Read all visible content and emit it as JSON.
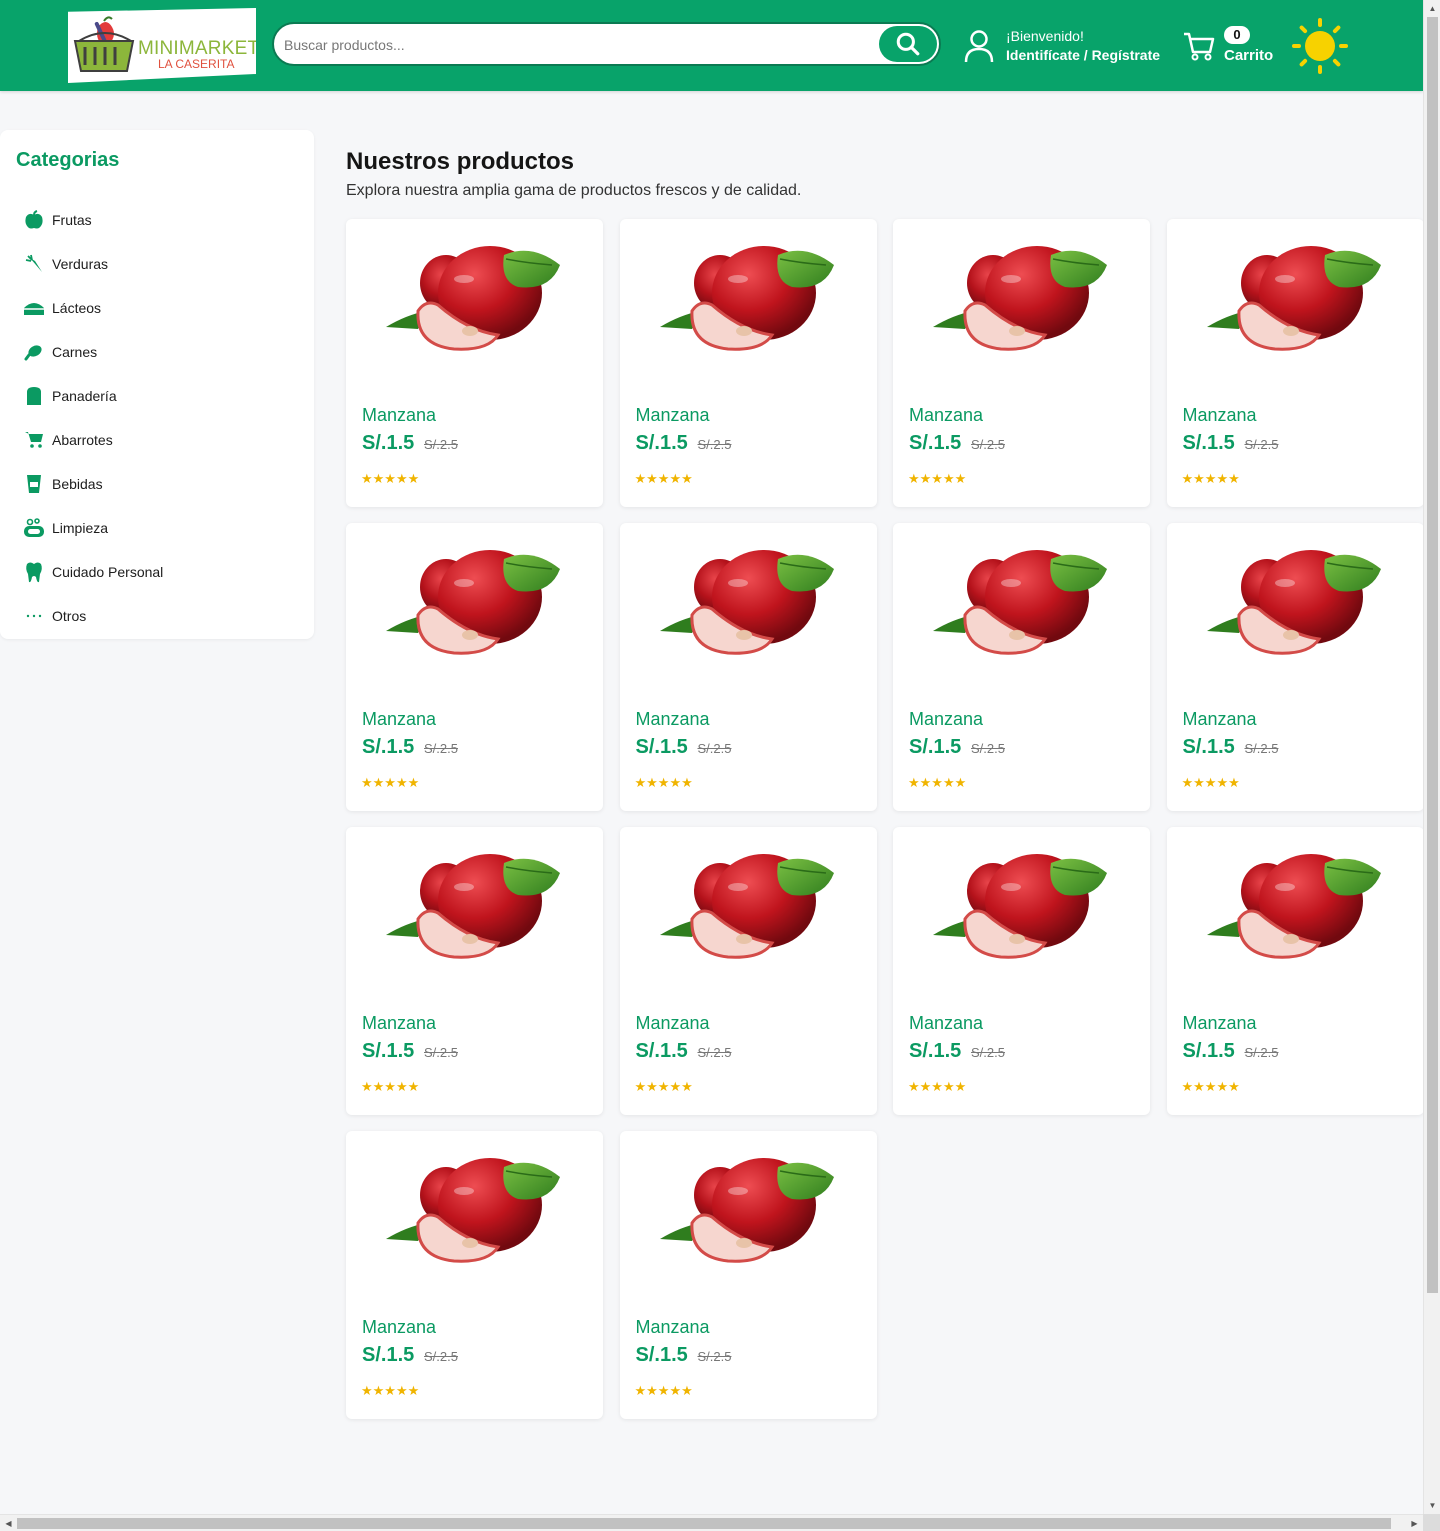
{
  "header": {
    "logo_main": "MINIMARKET",
    "logo_sub": "LA CASERITA",
    "search_placeholder": "Buscar productos...",
    "account_welcome": "¡Bienvenido!",
    "account_login": "Identifícate / Regístrate",
    "cart_count": "0",
    "cart_label": "Carrito"
  },
  "sidebar": {
    "title": "Categorias",
    "items": [
      {
        "label": "Frutas",
        "icon": "apple-icon"
      },
      {
        "label": "Verduras",
        "icon": "carrot-icon"
      },
      {
        "label": "Lácteos",
        "icon": "cheese-icon"
      },
      {
        "label": "Carnes",
        "icon": "meat-icon"
      },
      {
        "label": "Panadería",
        "icon": "bread-icon"
      },
      {
        "label": "Abarrotes",
        "icon": "cart-icon"
      },
      {
        "label": "Bebidas",
        "icon": "cup-icon"
      },
      {
        "label": "Limpieza",
        "icon": "soap-icon"
      },
      {
        "label": "Cuidado Personal",
        "icon": "tooth-icon"
      },
      {
        "label": "Otros",
        "icon": "ellipsis-icon"
      }
    ]
  },
  "main": {
    "title": "Nuestros productos",
    "subtitle": "Explora nuestra amplia gama de productos frescos y de calidad."
  },
  "products": [
    {
      "name": "Manzana",
      "price": "S/.1.5",
      "old_price": "S/.2.5",
      "rating": "★★★★★"
    },
    {
      "name": "Manzana",
      "price": "S/.1.5",
      "old_price": "S/.2.5",
      "rating": "★★★★★"
    },
    {
      "name": "Manzana",
      "price": "S/.1.5",
      "old_price": "S/.2.5",
      "rating": "★★★★★"
    },
    {
      "name": "Manzana",
      "price": "S/.1.5",
      "old_price": "S/.2.5",
      "rating": "★★★★★"
    },
    {
      "name": "Manzana",
      "price": "S/.1.5",
      "old_price": "S/.2.5",
      "rating": "★★★★★"
    },
    {
      "name": "Manzana",
      "price": "S/.1.5",
      "old_price": "S/.2.5",
      "rating": "★★★★★"
    },
    {
      "name": "Manzana",
      "price": "S/.1.5",
      "old_price": "S/.2.5",
      "rating": "★★★★★"
    },
    {
      "name": "Manzana",
      "price": "S/.1.5",
      "old_price": "S/.2.5",
      "rating": "★★★★★"
    },
    {
      "name": "Manzana",
      "price": "S/.1.5",
      "old_price": "S/.2.5",
      "rating": "★★★★★"
    },
    {
      "name": "Manzana",
      "price": "S/.1.5",
      "old_price": "S/.2.5",
      "rating": "★★★★★"
    },
    {
      "name": "Manzana",
      "price": "S/.1.5",
      "old_price": "S/.2.5",
      "rating": "★★★★★"
    },
    {
      "name": "Manzana",
      "price": "S/.1.5",
      "old_price": "S/.2.5",
      "rating": "★★★★★"
    },
    {
      "name": "Manzana",
      "price": "S/.1.5",
      "old_price": "S/.2.5",
      "rating": "★★★★★"
    },
    {
      "name": "Manzana",
      "price": "S/.1.5",
      "old_price": "S/.2.5",
      "rating": "★★★★★"
    }
  ],
  "colors": {
    "brand": "#08a36a",
    "brand_text": "#0b9a62",
    "star": "#f0b400",
    "sun": "#f7d200"
  }
}
